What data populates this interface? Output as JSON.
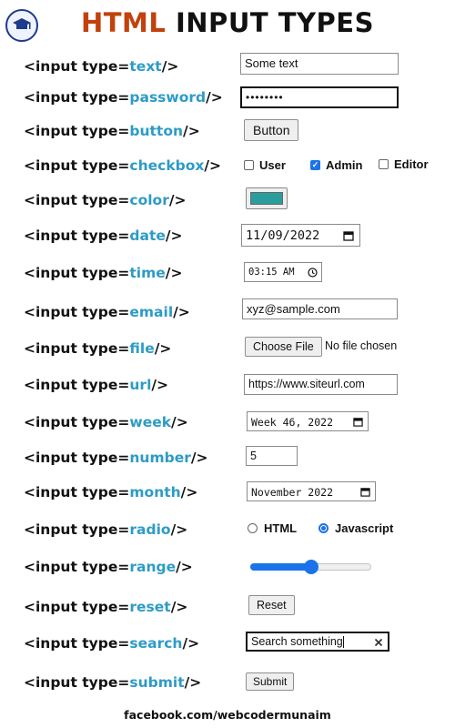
{
  "title": {
    "accent": "HTML",
    "rest": "INPUT TYPES"
  },
  "rows": [
    {
      "prefix": "<input type=",
      "type": "text",
      "suffix": "/>"
    },
    {
      "prefix": "<input type=",
      "type": "password",
      "suffix": "/>"
    },
    {
      "prefix": "<input type=",
      "type": "button",
      "suffix": "/>"
    },
    {
      "prefix": "<input type=",
      "type": "checkbox",
      "suffix": "/>"
    },
    {
      "prefix": "<input type=",
      "type": "color",
      "suffix": "/>"
    },
    {
      "prefix": "<input type=",
      "type": "date",
      "suffix": "/>"
    },
    {
      "prefix": "<input type=",
      "type": "time",
      "suffix": "/>"
    },
    {
      "prefix": "<input type=",
      "type": "email",
      "suffix": "/>"
    },
    {
      "prefix": "<input type=",
      "type": "file",
      "suffix": "/>"
    },
    {
      "prefix": "<input type=",
      "type": "url",
      "suffix": "/>"
    },
    {
      "prefix": "<input type=",
      "type": "week",
      "suffix": "/>"
    },
    {
      "prefix": "<input type=",
      "type": "number",
      "suffix": "/>"
    },
    {
      "prefix": "<input type=",
      "type": "month",
      "suffix": "/>"
    },
    {
      "prefix": "<input type=",
      "type": "radio",
      "suffix": "/>"
    },
    {
      "prefix": "<input type=",
      "type": "range",
      "suffix": "/>"
    },
    {
      "prefix": "<input type=",
      "type": "reset",
      "suffix": "/>"
    },
    {
      "prefix": "<input type=",
      "type": "search",
      "suffix": "/>"
    },
    {
      "prefix": "<input type=",
      "type": "submit",
      "suffix": "/>"
    }
  ],
  "demo": {
    "text_value": "Some text",
    "password_value": "••••••••",
    "button_label": "Button",
    "checkboxes": [
      {
        "label": "User",
        "checked": false
      },
      {
        "label": "Admin",
        "checked": true
      },
      {
        "label": "Editor",
        "checked": false
      }
    ],
    "color_value": "#2a9d9d",
    "date_value": "11/09/2022",
    "time_value": "03:15 AM",
    "email_value": "xyz@sample.com",
    "file_button": "Choose File",
    "file_status": "No file chosen",
    "url_value": "https://www.siteurl.com",
    "week_value": "Week 46, 2022",
    "number_value": "5",
    "month_value": "November 2022",
    "radios": [
      {
        "label": "HTML",
        "checked": false
      },
      {
        "label": "Javascript",
        "checked": true
      }
    ],
    "range_fraction": 0.5,
    "reset_label": "Reset",
    "search_value": "Search something",
    "submit_label": "Submit"
  },
  "icons": {
    "calendar": "calendar-icon",
    "clock": "clock-icon",
    "clear": "clear-icon",
    "logo": "logo-icon"
  },
  "colors": {
    "accent_title": "#c2410c",
    "keyword": "#2e9bc6",
    "range_fill": "#1a73e8"
  },
  "footer": "facebook.com/webcodermunaim"
}
